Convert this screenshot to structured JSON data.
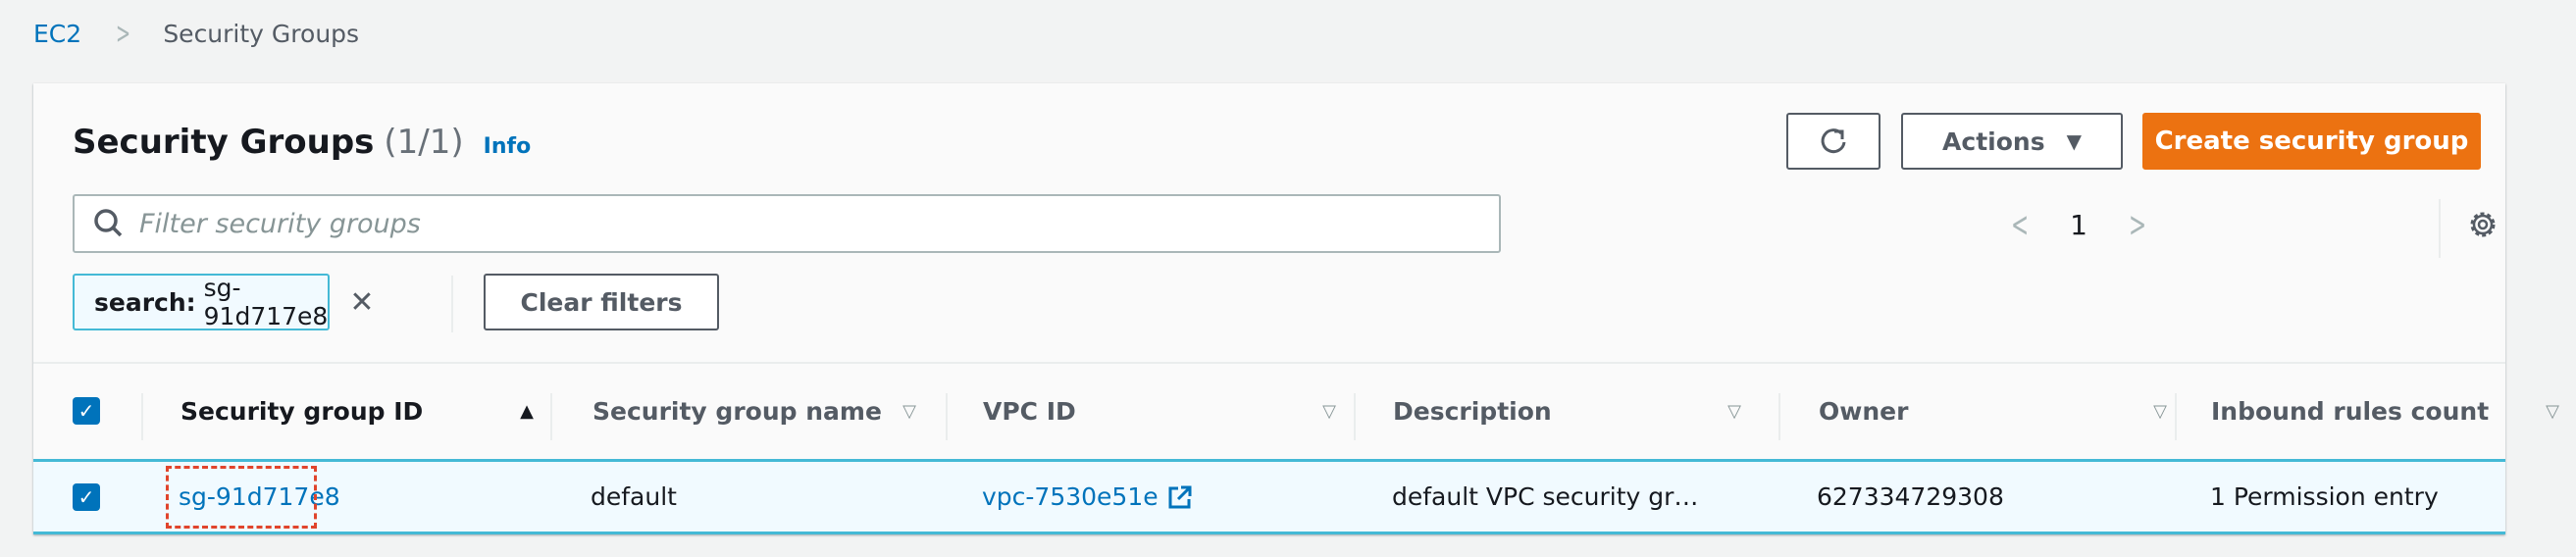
{
  "breadcrumb": {
    "root": "EC2",
    "current": "Security Groups"
  },
  "header": {
    "title": "Security Groups",
    "count": "(1/1)",
    "info": "Info"
  },
  "toolbar": {
    "actions_label": "Actions",
    "create_label": "Create security group"
  },
  "filter": {
    "placeholder": "Filter security groups",
    "value": ""
  },
  "pagination": {
    "current_page": "1"
  },
  "token": {
    "key": "search:",
    "value": "sg-91d717e8"
  },
  "clear_filters_label": "Clear filters",
  "table": {
    "columns": [
      {
        "label": "Security group ID",
        "sort": "ascending"
      },
      {
        "label": "Security group name",
        "sort": "none"
      },
      {
        "label": "VPC ID",
        "sort": "none"
      },
      {
        "label": "Description",
        "sort": "none"
      },
      {
        "label": "Owner",
        "sort": "none"
      },
      {
        "label": "Inbound rules count",
        "sort": "none"
      }
    ],
    "rows": [
      {
        "selected": true,
        "id": "sg-91d717e8",
        "name": "default",
        "vpc_id": "vpc-7530e51e",
        "description": "default VPC security gr…",
        "owner": "627334729308",
        "inbound": "1 Permission entry"
      }
    ]
  },
  "colors": {
    "accent": "#0073bb",
    "primary_button": "#ec7211",
    "selected_row": "#f1faff",
    "highlight": "#e0442c"
  }
}
